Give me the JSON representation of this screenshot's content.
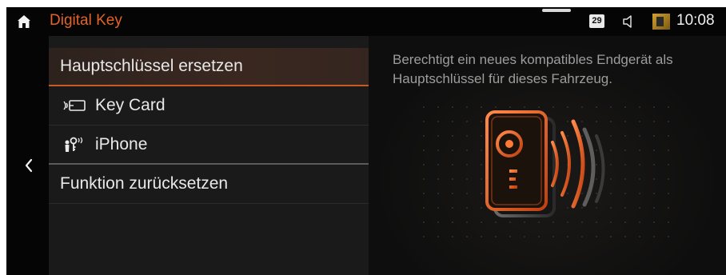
{
  "statusbar": {
    "app_title": "Digital Key",
    "date_day": "29",
    "time": "10:08"
  },
  "menu": {
    "items": [
      {
        "label": "Hauptschlüssel ersetzen",
        "selected": true
      },
      {
        "label": "Key Card",
        "icon": "key-card-icon"
      },
      {
        "label": "iPhone",
        "icon": "iphone-key-icon"
      },
      {
        "label": "Funktion zurücksetzen"
      }
    ]
  },
  "info": {
    "description": "Berechtigt ein neues kompatibles Endgerät als Hauptschlüssel für dieses Fahrzeug."
  },
  "colors": {
    "accent": "#e3622a",
    "background": "#0e0e0e",
    "menu_bg": "#1a1a1a",
    "text": "#e8e8e8",
    "muted_text": "#9d9d9d"
  }
}
